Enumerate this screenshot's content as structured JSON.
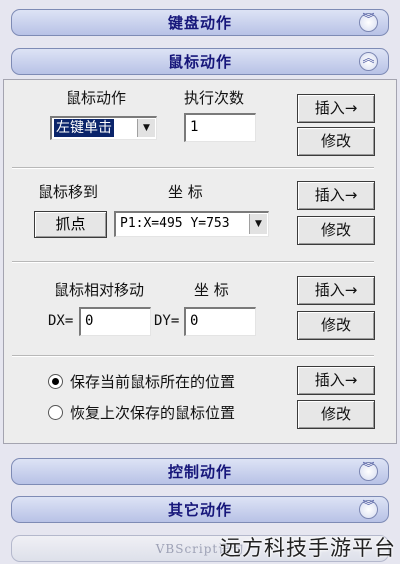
{
  "sections": {
    "keyboard": "键盘动作",
    "mouse": "鼠标动作",
    "control": "控制动作",
    "other": "其它动作",
    "vbscript": "VBScript语句"
  },
  "mouse_action": {
    "label": "鼠标动作",
    "exec_label": "执行次数",
    "selected": "左键单击",
    "count": "1",
    "insert": "插入→",
    "modify": "修改"
  },
  "move_to": {
    "label": "鼠标移到",
    "coord_label": "坐 标",
    "grab_button": "抓点",
    "point": "P1:X=495 Y=753",
    "insert": "插入→",
    "modify": "修改"
  },
  "relative_move": {
    "label": "鼠标相对移动",
    "coord_label": "坐 标",
    "dx_label": "DX=",
    "dx_value": "0",
    "dy_label": "DY=",
    "dy_value": "0",
    "insert": "插入→",
    "modify": "修改"
  },
  "position": {
    "save_label": "保存当前鼠标所在的位置",
    "restore_label": "恢复上次保存的鼠标位置",
    "insert": "插入→",
    "modify": "修改"
  },
  "watermark": "远方科技手游平台",
  "icons": {
    "collapse": "double-chevron-up-icon",
    "expand": "double-chevron-down-icon",
    "dropdown": "dropdown-arrow-icon"
  }
}
